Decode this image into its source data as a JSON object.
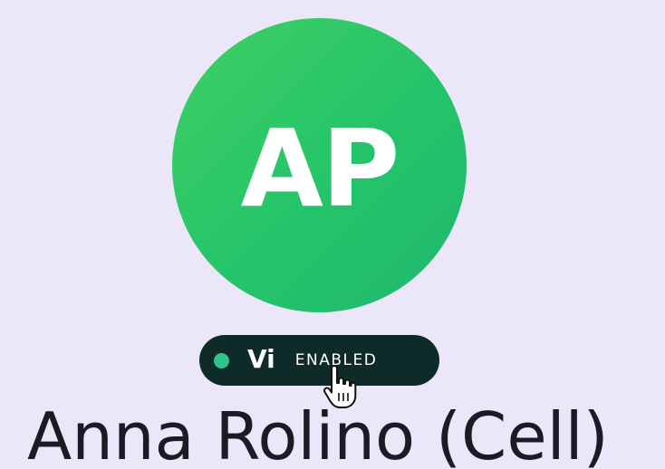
{
  "avatar": {
    "initials": "AP",
    "color": "#2dc866"
  },
  "badge": {
    "brand": "Vi",
    "status": "ENABLED",
    "dot_color": "#2fc48a",
    "background": "#0e2a29"
  },
  "cursor_icon": "hand-pointer-icon",
  "contact": {
    "name": "Anna Rolino (Cell)"
  }
}
